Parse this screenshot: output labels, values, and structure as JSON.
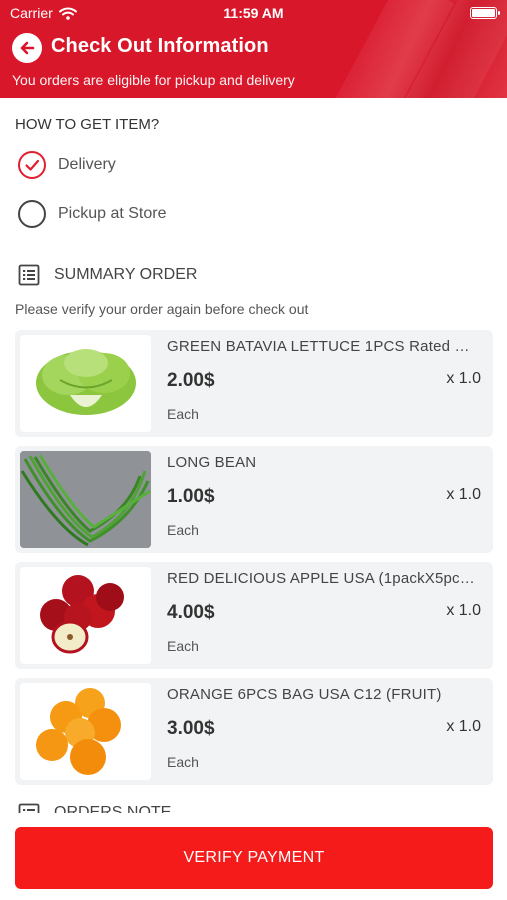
{
  "status_bar": {
    "carrier": "Carrier",
    "time": "11:59 AM"
  },
  "header": {
    "title": "Check Out Information",
    "subtitle": "You orders are eligible for pickup and delivery",
    "brand_color": "#d9172b"
  },
  "delivery": {
    "label": "HOW TO GET ITEM?",
    "options": [
      {
        "label": "Delivery",
        "selected": true
      },
      {
        "label": "Pickup at Store",
        "selected": false
      }
    ]
  },
  "summary": {
    "title": "SUMMARY ORDER",
    "hint": "Please verify your order again before check out",
    "items": [
      {
        "name": "GREEN BATAVIA LETTUCE 1PCS Rated …",
        "price": "2.00$",
        "qty": "x 1.0",
        "unit": "Each",
        "image": "lettuce"
      },
      {
        "name": "LONG BEAN",
        "price": "1.00$",
        "qty": "x 1.0",
        "unit": "Each",
        "image": "long-bean"
      },
      {
        "name": "RED DELICIOUS APPLE USA (1packX5pc…",
        "price": "4.00$",
        "qty": "x 1.0",
        "unit": "Each",
        "image": "apple"
      },
      {
        "name": "ORANGE 6PCS BAG USA C12 (FRUIT)",
        "price": "3.00$",
        "qty": "x 1.0",
        "unit": "Each",
        "image": "orange"
      }
    ]
  },
  "orders_note": {
    "title": "ORDERS NOTE"
  },
  "footer": {
    "verify_label": "VERIFY PAYMENT",
    "button_color": "#f51b1b"
  }
}
